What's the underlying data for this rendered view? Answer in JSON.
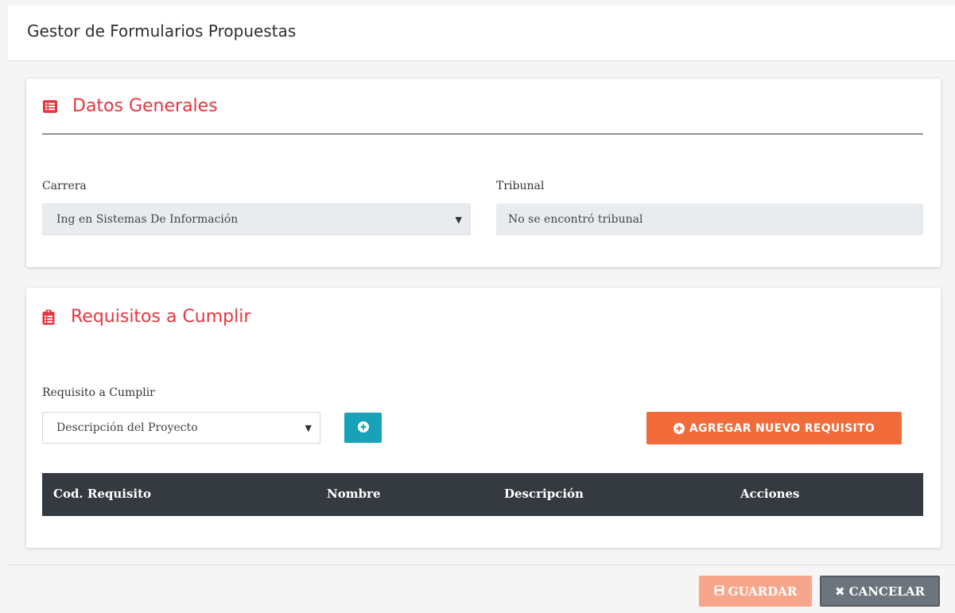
{
  "modal": {
    "title": "Gestor de Formularios Propuestas"
  },
  "general": {
    "title": "Datos Generales",
    "icon": "list-alt-icon",
    "carrera_label": "Carrera",
    "carrera_value": "Ing en Sistemas De Información",
    "tribunal_label": "Tribunal",
    "tribunal_value": "No se encontró tribunal"
  },
  "requisitos": {
    "title": "Requisitos a Cumplir",
    "icon": "clipboard-list-icon",
    "select_label": "Requisito a Cumplir",
    "select_value": "Descripción del Proyecto",
    "new_button_label": "AGREGAR NUEVO REQUISITO",
    "table": {
      "columns": [
        "Cod. Requisito",
        "Nombre",
        "Descripción",
        "Acciones"
      ],
      "rows": []
    }
  },
  "footer": {
    "save_label": "GUARDAR",
    "cancel_label": "CANCELAR"
  },
  "colors": {
    "accent_red": "#e5363f",
    "info_button": "#17a2b8",
    "orange_button": "#f26b3a",
    "table_header": "#343a40",
    "save_button": "#f7a58b",
    "cancel_button": "#6c757d"
  }
}
